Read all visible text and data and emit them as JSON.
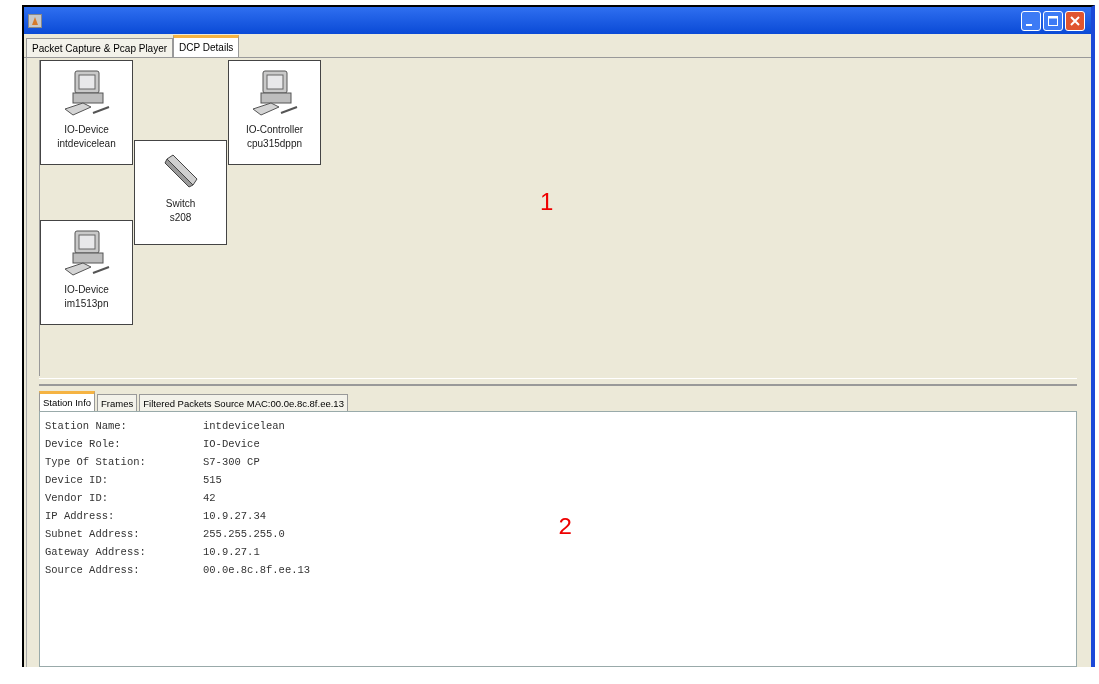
{
  "tabs": [
    {
      "label": "Packet Capture & Pcap Player",
      "selected": false
    },
    {
      "label": "DCP Details",
      "selected": true
    }
  ],
  "topology": {
    "nodes": [
      {
        "kind": "pc",
        "role": "IO-Device",
        "name": "intdevicelean"
      },
      {
        "kind": "pc",
        "role": "IO-Controller",
        "name": "cpu315dppn"
      },
      {
        "kind": "switch",
        "role": "Switch",
        "name": "s208"
      },
      {
        "kind": "pc",
        "role": "IO-Device",
        "name": "im1513pn"
      }
    ],
    "annotation": "1"
  },
  "detail_tabs": [
    {
      "label": "Station Info",
      "selected": true
    },
    {
      "label": "Frames",
      "selected": false
    },
    {
      "label": "Filtered Packets Source MAC:00.0e.8c.8f.ee.13",
      "selected": false
    }
  ],
  "station_info": [
    {
      "label": "Station Name:",
      "value": "intdevicelean"
    },
    {
      "label": "Device Role:",
      "value": "IO-Device"
    },
    {
      "label": "Type Of Station:",
      "value": "S7-300 CP"
    },
    {
      "label": "Device ID:",
      "value": "515"
    },
    {
      "label": "Vendor ID:",
      "value": "42"
    },
    {
      "label": "IP Address:",
      "value": "10.9.27.34"
    },
    {
      "label": "Subnet Address:",
      "value": "255.255.255.0"
    },
    {
      "label": "Gateway Address:",
      "value": "10.9.27.1"
    },
    {
      "label": "Source Address:",
      "value": "00.0e.8c.8f.ee.13"
    }
  ],
  "detail_annotation": "2"
}
